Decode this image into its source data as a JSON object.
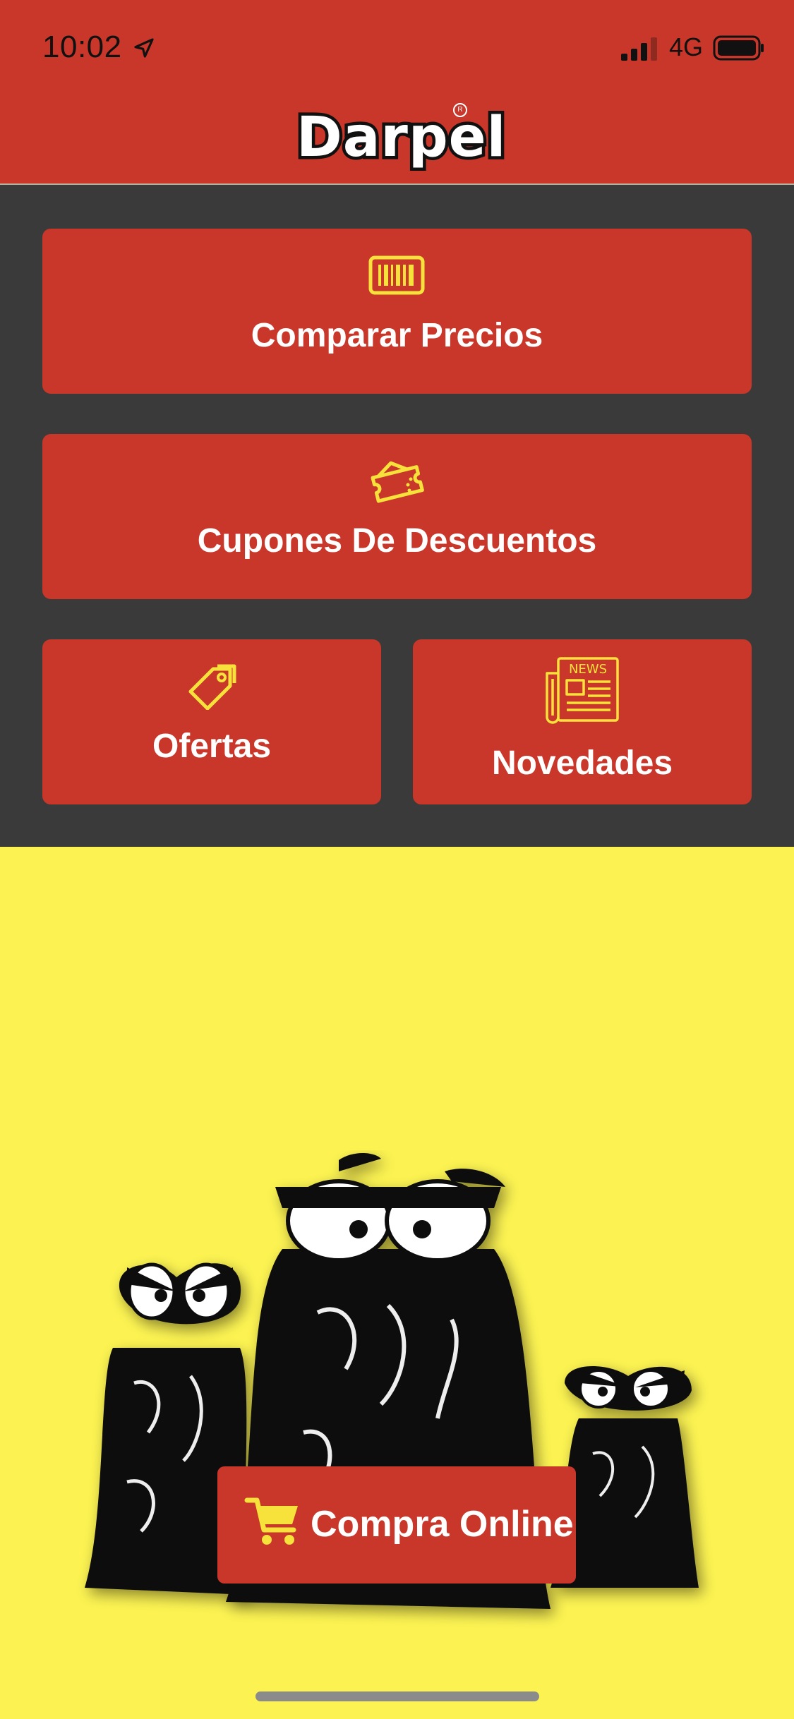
{
  "status_bar": {
    "time": "10:02",
    "network": "4G"
  },
  "header": {
    "logo_text": "Darpel",
    "logo_reg": "R"
  },
  "menu": {
    "compare_prices": "Comparar Precios",
    "coupons": "Cupones De Descuentos",
    "offers": "Ofertas",
    "news": "Novedades",
    "news_icon_text": "NEWS"
  },
  "buy_online": {
    "label": "Compra Online"
  },
  "colors": {
    "primary_red": "#C8372A",
    "dark_bg": "#3A3A3A",
    "yellow_bg": "#FCF352",
    "icon_yellow": "#F6E23A"
  }
}
